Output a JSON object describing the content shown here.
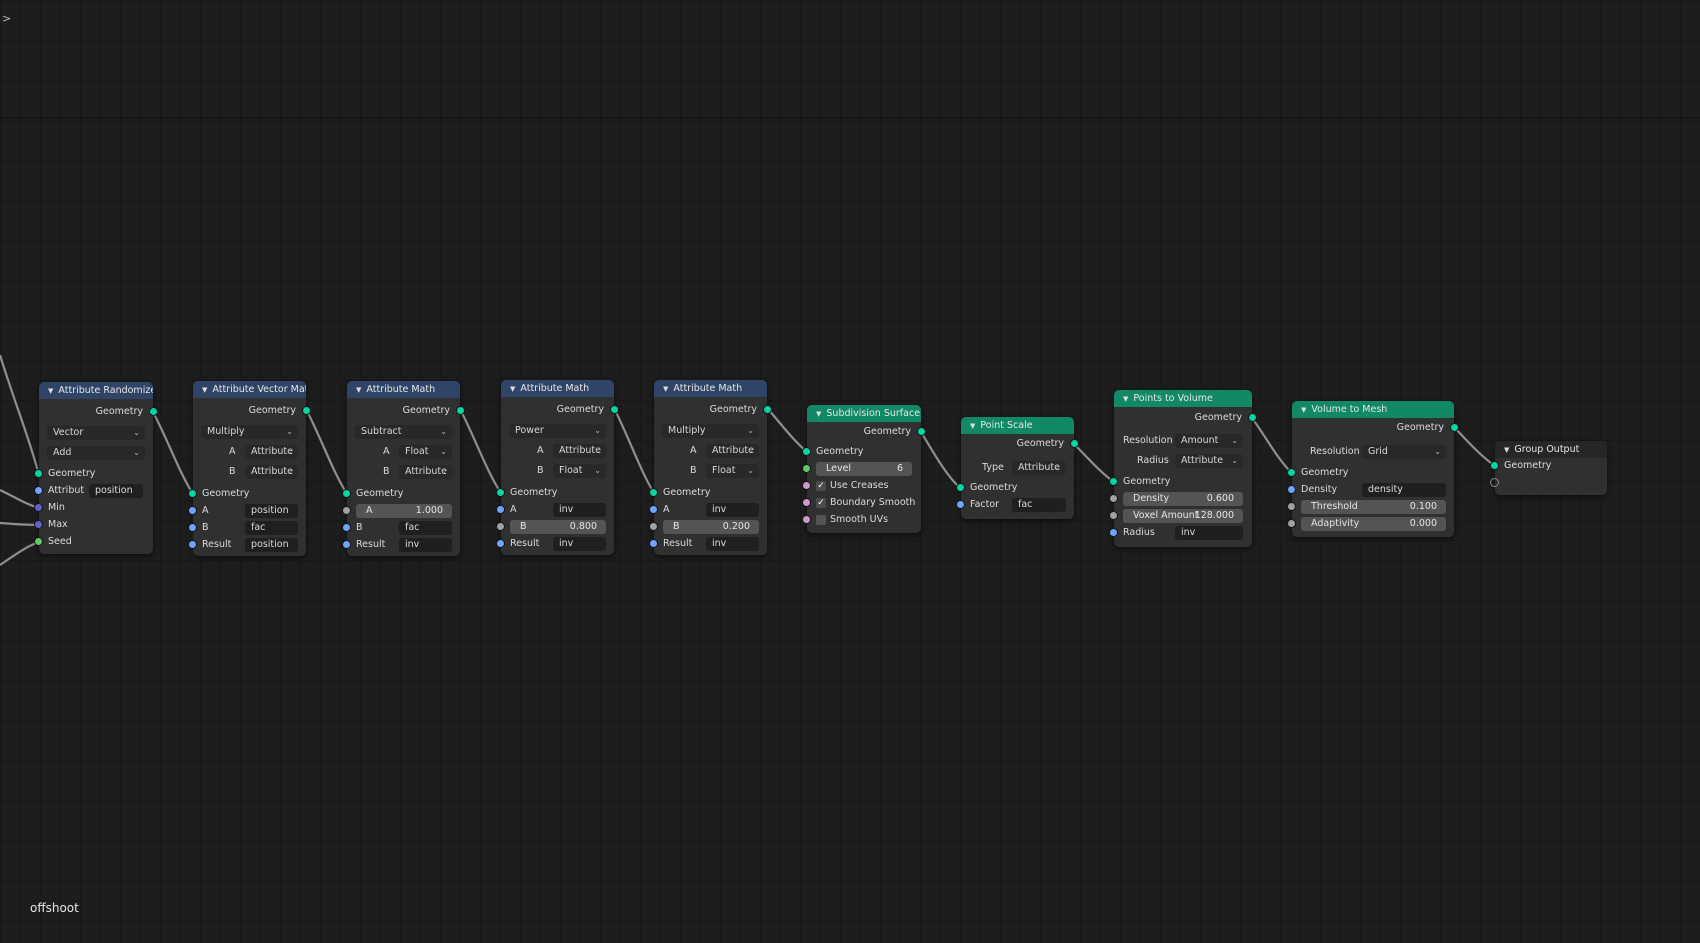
{
  "corner_arrow": ">",
  "tree_name": "offshoot",
  "nodes": {
    "randomize": {
      "title": "Attribute Randomize",
      "out": "Geometry",
      "dd1": "Vector",
      "dd2": "Add",
      "in_geometry": "Geometry",
      "attr_label": "Attribut",
      "attr_value": "position",
      "min": "Min",
      "max": "Max",
      "seed": "Seed"
    },
    "vecmath": {
      "title": "Attribute Vector Math",
      "out": "Geometry",
      "op": "Multiply",
      "a_label": "A",
      "a_type": "Attribute",
      "b_label": "B",
      "b_type": "Attribute",
      "in_geometry": "Geometry",
      "a": "A",
      "a_value": "position",
      "b": "B",
      "b_value": "fac",
      "result": "Result",
      "result_value": "position"
    },
    "math1": {
      "title": "Attribute Math",
      "out": "Geometry",
      "op": "Subtract",
      "a_label": "A",
      "a_type": "Float",
      "b_label": "B",
      "b_type": "Attribute",
      "in_geometry": "Geometry",
      "a": "A",
      "a_value": "1.000",
      "b": "B",
      "b_value": "fac",
      "result": "Result",
      "result_value": "inv"
    },
    "math2": {
      "title": "Attribute Math",
      "out": "Geometry",
      "op": "Power",
      "a_label": "A",
      "a_type": "Attribute",
      "b_label": "B",
      "b_type": "Float",
      "in_geometry": "Geometry",
      "a": "A",
      "a_value": "inv",
      "b": "B",
      "b_value": "0.800",
      "result": "Result",
      "result_value": "inv"
    },
    "math3": {
      "title": "Attribute Math",
      "out": "Geometry",
      "op": "Multiply",
      "a_label": "A",
      "a_type": "Attribute",
      "b_label": "B",
      "b_type": "Float",
      "in_geometry": "Geometry",
      "a": "A",
      "a_value": "inv",
      "b": "B",
      "b_value": "0.200",
      "result": "Result",
      "result_value": "inv"
    },
    "subdiv": {
      "title": "Subdivision Surface",
      "out": "Geometry",
      "in_geometry": "Geometry",
      "level_label": "Level",
      "level_value": "6",
      "use_creases": "Use Creases",
      "use_creases_checked": true,
      "boundary_smooth": "Boundary Smooth",
      "boundary_smooth_checked": true,
      "smooth_uvs": "Smooth UVs",
      "smooth_uvs_checked": false
    },
    "pointscale": {
      "title": "Point Scale",
      "out": "Geometry",
      "type_label": "Type",
      "type_value": "Attribute",
      "in_geometry": "Geometry",
      "factor": "Factor",
      "factor_value": "fac"
    },
    "p2v": {
      "title": "Points to Volume",
      "out": "Geometry",
      "resolution_label": "Resolution",
      "resolution_value": "Amount",
      "radius_label": "Radius",
      "radius_mode": "Attribute",
      "in_geometry": "Geometry",
      "density_label": "Density",
      "density_value": "0.600",
      "voxel_label": "Voxel Amount",
      "voxel_value": "128.000",
      "radius": "Radius",
      "radius_value": "inv"
    },
    "v2m": {
      "title": "Volume to Mesh",
      "out": "Geometry",
      "resolution_label": "Resolution",
      "resolution_value": "Grid",
      "in_geometry": "Geometry",
      "density": "Density",
      "density_value": "density",
      "threshold_label": "Threshold",
      "threshold_value": "0.100",
      "adaptivity_label": "Adaptivity",
      "adaptivity_value": "0.000"
    },
    "output": {
      "title": "Group Output",
      "in_geometry": "Geometry"
    }
  },
  "colors": {
    "background": "#1d1d1d",
    "node_body": "#303030",
    "header_attribute": "#2f4466",
    "header_geometry": "#118866",
    "header_output": "#262626",
    "socket_geometry": "#00d6a3",
    "socket_vector": "#6363c7",
    "socket_string": "#6fa3ff",
    "socket_float": "#a1a1a1",
    "socket_int": "#63c763",
    "socket_bool": "#cc99cc",
    "wire": "#8f8f8f"
  }
}
